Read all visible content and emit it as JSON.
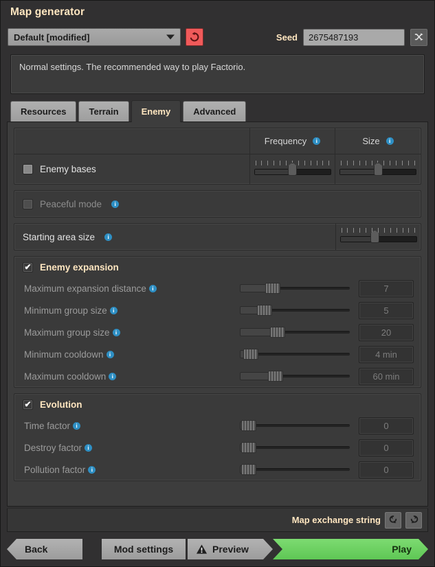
{
  "window": {
    "title": "Map generator"
  },
  "top": {
    "preset_value": "Default [modified]",
    "reset_icon": "reset-arrow-icon",
    "seed_label": "Seed",
    "seed_value": "2675487193",
    "seed_placeholder": "Seed",
    "shuffle_icon": "shuffle-icon"
  },
  "description": {
    "text": "Normal settings. The recommended way to play Factorio."
  },
  "tabs": [
    {
      "label": "Resources",
      "active": false
    },
    {
      "label": "Terrain",
      "active": false
    },
    {
      "label": "Enemy",
      "active": true
    },
    {
      "label": "Advanced",
      "active": false
    }
  ],
  "enemy": {
    "columns": [
      {
        "label": "Frequency",
        "info": "info-icon"
      },
      {
        "label": "Size",
        "info": "info-icon"
      }
    ],
    "bases": {
      "label": "Enemy bases",
      "checked": false,
      "frequency": 50,
      "size": 50
    },
    "peaceful_mode": {
      "label": "Peaceful mode",
      "checked": false
    },
    "starting_area": {
      "label": "Starting area size",
      "value": 45
    }
  },
  "expansion": {
    "title": "Enemy expansion",
    "checked": true,
    "rows": [
      {
        "label": "Maximum expansion distance",
        "value": "7",
        "pos": 29
      },
      {
        "label": "Minimum group size",
        "value": "5",
        "pos": 21
      },
      {
        "label": "Maximum group size",
        "value": "20",
        "pos": 34
      },
      {
        "label": "Minimum cooldown",
        "value": "4 min",
        "pos": 7
      },
      {
        "label": "Maximum cooldown",
        "value": "60 min",
        "pos": 32
      }
    ]
  },
  "evolution": {
    "title": "Evolution",
    "checked": true,
    "rows": [
      {
        "label": "Time factor",
        "value": "0",
        "pos": 5
      },
      {
        "label": "Destroy factor",
        "value": "0",
        "pos": 5
      },
      {
        "label": "Pollution factor",
        "value": "0",
        "pos": 5
      }
    ]
  },
  "map_exchange": {
    "label": "Map exchange string",
    "import_icon": "import-rotate-icon",
    "export_icon": "export-rotate-icon"
  },
  "footer": {
    "back": "Back",
    "mod_settings": "Mod settings",
    "preview": "Preview",
    "preview_icon": "warning-triangle-icon",
    "play": "Play"
  },
  "colors": {
    "accent_text": "#ffe6c0",
    "play_green": "#68cf5c",
    "reset_red": "#f05a5a",
    "info_blue": "#2e8fc4",
    "panel_bg": "#3d3d3d"
  }
}
